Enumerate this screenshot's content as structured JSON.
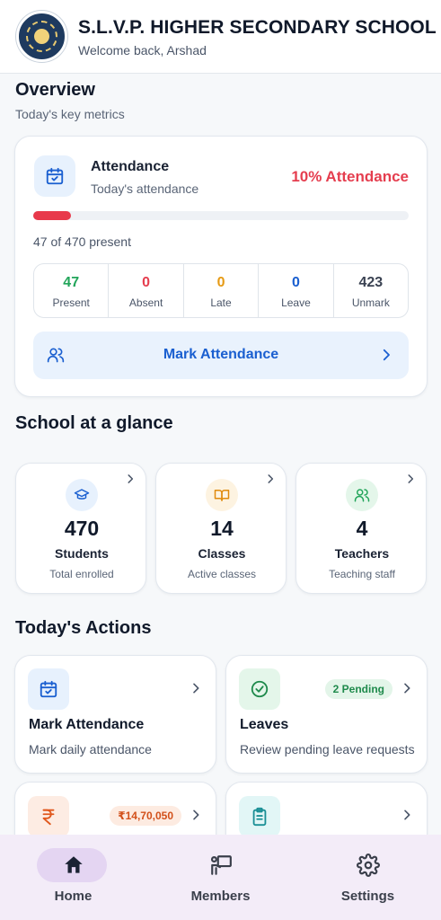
{
  "header": {
    "school_name": "S.L.V.P. HIGHER SECONDARY SCHOOL",
    "welcome": "Welcome back, Arshad"
  },
  "overview": {
    "title": "Overview",
    "subtitle": "Today's key metrics"
  },
  "attendance": {
    "title": "Attendance",
    "subtitle": "Today's attendance",
    "percent_label": "10% Attendance",
    "progress_fraction": 0.1,
    "count_text": "47 of 470 present",
    "stats": [
      {
        "value": "47",
        "label": "Present",
        "color": "#22a55a"
      },
      {
        "value": "0",
        "label": "Absent",
        "color": "#e53e4f"
      },
      {
        "value": "0",
        "label": "Late",
        "color": "#e69a14"
      },
      {
        "value": "0",
        "label": "Leave",
        "color": "#1a5fd0"
      },
      {
        "value": "423",
        "label": "Unmark",
        "color": "#3a4252"
      }
    ],
    "mark_button": "Mark Attendance"
  },
  "glance": {
    "title": "School at a glance",
    "cards": [
      {
        "value": "470",
        "label": "Students",
        "sub": "Total enrolled",
        "icon": "graduation-cap-icon"
      },
      {
        "value": "14",
        "label": "Classes",
        "sub": "Active classes",
        "icon": "book-icon"
      },
      {
        "value": "4",
        "label": "Teachers",
        "sub": "Teaching staff",
        "icon": "users-icon"
      }
    ]
  },
  "actions": {
    "title": "Today's Actions",
    "items": [
      {
        "title": "Mark Attendance",
        "sub": "Mark daily attendance",
        "icon": "calendar-check-icon"
      },
      {
        "title": "Leaves",
        "sub": "Review pending leave requests",
        "badge": "2 Pending",
        "icon": "check-circle-icon"
      },
      {
        "title": "",
        "sub": "",
        "badge": "₹14,70,050",
        "icon": "rupee-icon"
      },
      {
        "title": "",
        "sub": "",
        "icon": "clipboard-list-icon"
      }
    ]
  },
  "nav": {
    "home": "Home",
    "members": "Members",
    "settings": "Settings"
  },
  "colors": {
    "accent_blue": "#1a5fd0",
    "danger": "#e53e4f",
    "nav_bg": "#f3ecf8"
  }
}
